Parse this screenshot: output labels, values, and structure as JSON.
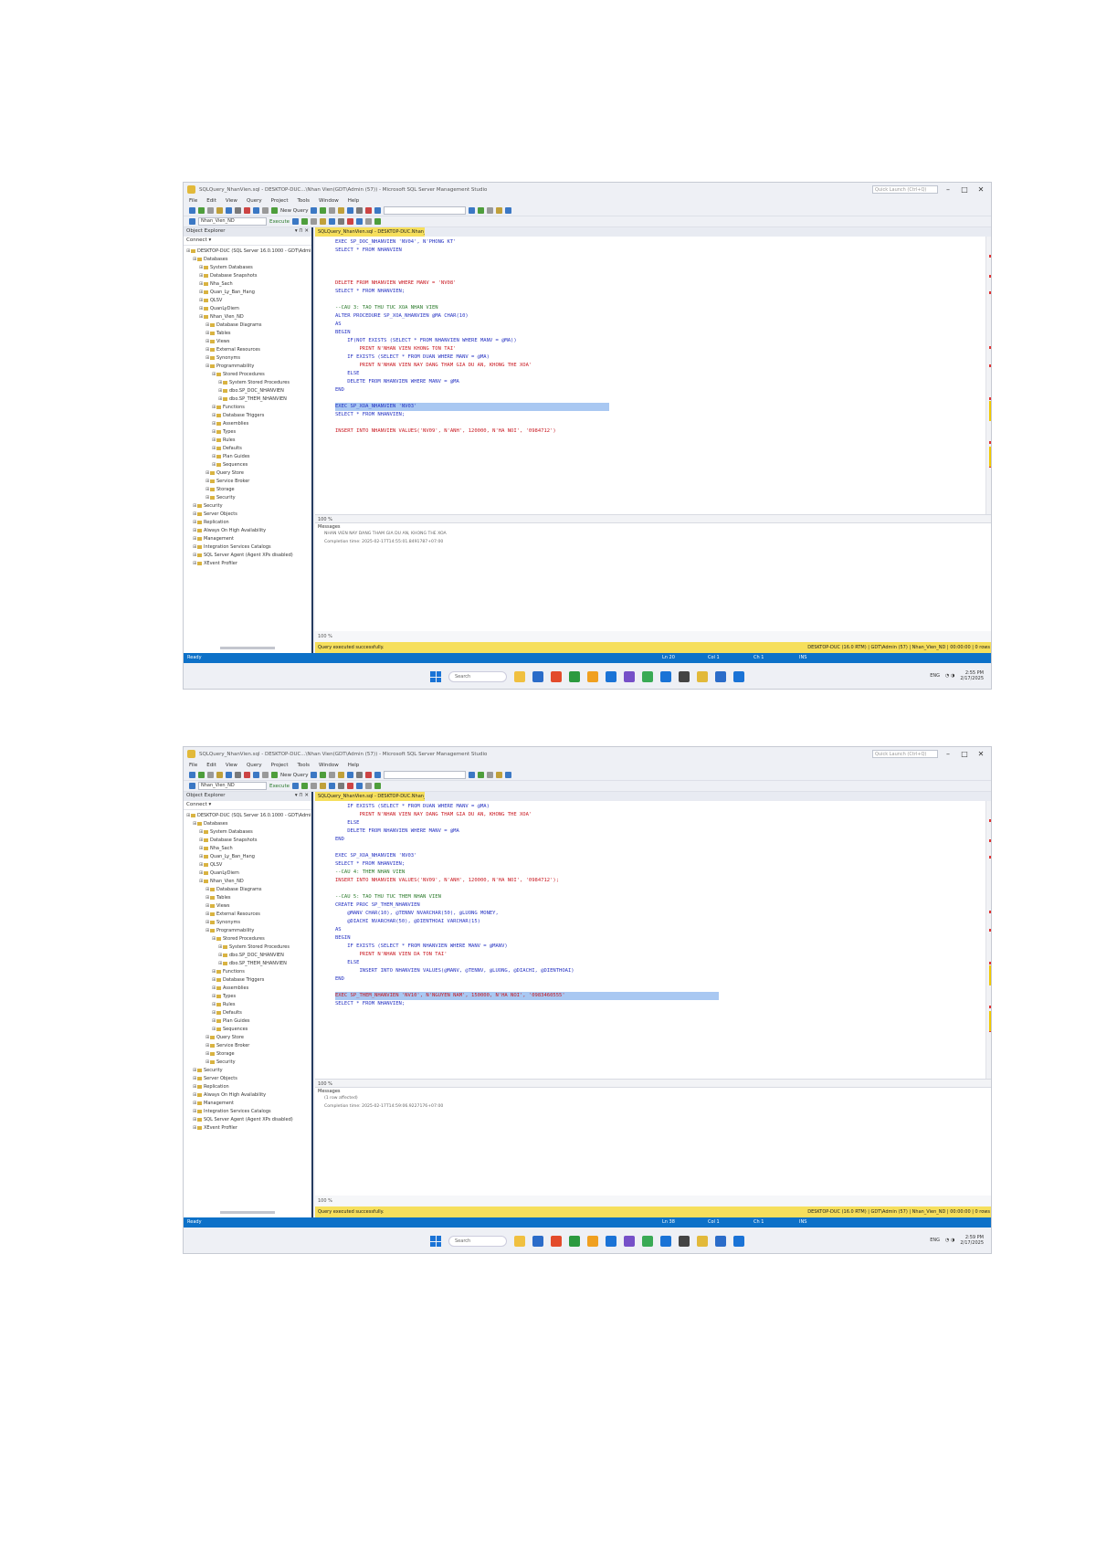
{
  "window": {
    "title": "SQLQuery_NhanVien.sql - DESKTOP-DUC...\\Nhan Vien(GDT\\Admin (57)) - Microsoft SQL Server Management Studio",
    "quick_launch": "Quick Launch (Ctrl+Q)",
    "minimize": "–",
    "maximize": "□",
    "close": "✕"
  },
  "menu": [
    "File",
    "Edit",
    "View",
    "Query",
    "Project",
    "Tools",
    "Window",
    "Help"
  ],
  "toolbar": {
    "new_query": "New Query",
    "database": "Nhan_Vien_ND",
    "execute": "Execute"
  },
  "object_explorer": {
    "title": "Object Explorer",
    "pin": "▾ ⊓ ✕",
    "connect": "Connect ▾",
    "tree": [
      {
        "indent": 0,
        "label": "DESKTOP-DUC (SQL Server 16.0.1000 - GDT\\Admin)"
      },
      {
        "indent": 1,
        "label": "Databases"
      },
      {
        "indent": 2,
        "label": "System Databases"
      },
      {
        "indent": 2,
        "label": "Database Snapshots"
      },
      {
        "indent": 2,
        "label": "Nha_Sach"
      },
      {
        "indent": 2,
        "label": "Quan_Ly_Ban_Hang"
      },
      {
        "indent": 2,
        "label": "QLSV"
      },
      {
        "indent": 2,
        "label": "QuanLyDiem"
      },
      {
        "indent": 2,
        "label": "Nhan_Vien_ND"
      },
      {
        "indent": 3,
        "label": "Database Diagrams"
      },
      {
        "indent": 3,
        "label": "Tables"
      },
      {
        "indent": 3,
        "label": "Views"
      },
      {
        "indent": 3,
        "label": "External Resources"
      },
      {
        "indent": 3,
        "label": "Synonyms"
      },
      {
        "indent": 3,
        "label": "Programmability"
      },
      {
        "indent": 4,
        "label": "Stored Procedures"
      },
      {
        "indent": 5,
        "label": "System Stored Procedures"
      },
      {
        "indent": 5,
        "label": "dbo.SP_DOC_NHANVIEN"
      },
      {
        "indent": 5,
        "label": "dbo.SP_THEM_NHANVIEN"
      },
      {
        "indent": 4,
        "label": "Functions"
      },
      {
        "indent": 4,
        "label": "Database Triggers"
      },
      {
        "indent": 4,
        "label": "Assemblies"
      },
      {
        "indent": 4,
        "label": "Types"
      },
      {
        "indent": 4,
        "label": "Rules"
      },
      {
        "indent": 4,
        "label": "Defaults"
      },
      {
        "indent": 4,
        "label": "Plan Guides"
      },
      {
        "indent": 4,
        "label": "Sequences"
      },
      {
        "indent": 3,
        "label": "Query Store"
      },
      {
        "indent": 3,
        "label": "Service Broker"
      },
      {
        "indent": 3,
        "label": "Storage"
      },
      {
        "indent": 3,
        "label": "Security"
      },
      {
        "indent": 1,
        "label": "Security"
      },
      {
        "indent": 1,
        "label": "Server Objects"
      },
      {
        "indent": 1,
        "label": "Replication"
      },
      {
        "indent": 1,
        "label": "Always On High Availability"
      },
      {
        "indent": 1,
        "label": "Management"
      },
      {
        "indent": 1,
        "label": "Integration Services Catalogs"
      },
      {
        "indent": 1,
        "label": "SQL Server Agent (Agent XPs disabled)"
      },
      {
        "indent": 1,
        "label": "XEvent Profiler"
      }
    ]
  },
  "tab": "SQLQuery_NhanVien.sql - DESKTOP-DUC.Nhan_Vien (57)* ✕",
  "screenshot1": {
    "code": [
      {
        "t": "EXEC SP_DOC_NHANVIEN 'NV04', N'PHONG KT'",
        "c": "blu"
      },
      {
        "t": "SELECT * FROM NHANVIEN",
        "c": "blu"
      },
      {
        "t": "",
        "c": "blk"
      },
      {
        "t": "",
        "c": "blk"
      },
      {
        "t": "",
        "c": "blk"
      },
      {
        "t": "DELETE FROM NHANVIEN WHERE MANV = 'NV08'",
        "c": "red"
      },
      {
        "t": "SELECT * FROM NHANVIEN;",
        "c": "blu"
      },
      {
        "t": "",
        "c": "blk"
      },
      {
        "t": "--CAU 3: TAO THU TUC XOA NHAN VIEN",
        "c": "grn"
      },
      {
        "t": "ALTER PROCEDURE SP_XOA_NHANVIEN @MA CHAR(10)",
        "c": "blu"
      },
      {
        "t": "AS",
        "c": "blu"
      },
      {
        "t": "BEGIN",
        "c": "blu"
      },
      {
        "t": "    IF(NOT EXISTS (SELECT * FROM NHANVIEN WHERE MANV = @MA))",
        "c": "blu"
      },
      {
        "t": "        PRINT N'NHAN VIEN KHONG TON TAI'",
        "c": "red"
      },
      {
        "t": "    IF EXISTS (SELECT * FROM DUAN WHERE MANV = @MA)",
        "c": "blu"
      },
      {
        "t": "        PRINT N'NHAN VIEN NAY DANG THAM GIA DU AN, KHONG THE XOA'",
        "c": "red"
      },
      {
        "t": "    ELSE",
        "c": "blu"
      },
      {
        "t": "    DELETE FROM NHANVIEN WHERE MANV = @MA",
        "c": "blu"
      },
      {
        "t": "END",
        "c": "blu"
      },
      {
        "t": "",
        "c": "blk"
      },
      {
        "t": "EXEC SP_XOA_NHANVIEN 'NV03'",
        "c": "blu",
        "hl": 1
      },
      {
        "t": "SELECT * FROM NHANVIEN;",
        "c": "blu"
      },
      {
        "t": "",
        "c": "blk"
      },
      {
        "t": "INSERT INTO NHANVIEN VALUES('NV09', N'ANH', 120000, N'HA NOI', '0984712')",
        "c": "red"
      }
    ],
    "zoom": "100 %",
    "messages_tab": "Messages",
    "messages": [
      "NHAN VIEN NAY DANG THAM GIA DU AN, KHONG THE XOA",
      "",
      "Completion time: 2025-02-17T14:55:01.8491787+07:00"
    ],
    "status_zoom": "100 %",
    "query_status": "Query executed successfully.",
    "query_info": "DESKTOP-DUC (16.0 RTM) | GDT\\Admin (57) | Nhan_Vien_ND | 00:00:00 | 0 rows",
    "ready": "Ready",
    "ln": "Ln 20",
    "col": "Col 1",
    "ch": "Ch 1",
    "ins": "INS",
    "search": "Search",
    "tray": "ENG",
    "time": "2:55 PM",
    "date": "2/17/2025"
  },
  "screenshot2": {
    "code": [
      {
        "t": "    IF EXISTS (SELECT * FROM DUAN WHERE MANV = @MA)",
        "c": "blu"
      },
      {
        "t": "        PRINT N'NHAN VIEN NAY DANG THAM GIA DU AN, KHONG THE XOA'",
        "c": "red"
      },
      {
        "t": "    ELSE",
        "c": "blu"
      },
      {
        "t": "    DELETE FROM NHANVIEN WHERE MANV = @MA",
        "c": "blu"
      },
      {
        "t": "END",
        "c": "blu"
      },
      {
        "t": "",
        "c": "blk"
      },
      {
        "t": "EXEC SP_XOA_NHANVIEN 'NV03'",
        "c": "blu"
      },
      {
        "t": "SELECT * FROM NHANVIEN;",
        "c": "blu"
      },
      {
        "t": "--CAU 4: THEM NHAN VIEN",
        "c": "grn"
      },
      {
        "t": "INSERT INTO NHANVIEN VALUES('NV09', N'ANH', 120000, N'HA NOI', '0984712');",
        "c": "red"
      },
      {
        "t": "",
        "c": "blk"
      },
      {
        "t": "--CAU 5: TAO THU TUC THEM NHAN VIEN",
        "c": "grn"
      },
      {
        "t": "CREATE PROC SP_THEM_NHANVIEN",
        "c": "blu"
      },
      {
        "t": "    @MANV CHAR(10), @TENNV NVARCHAR(50), @LUONG MONEY,",
        "c": "blu"
      },
      {
        "t": "    @DIACHI NVARCHAR(50), @DIENTHOAI VARCHAR(15)",
        "c": "blu"
      },
      {
        "t": "AS",
        "c": "blu"
      },
      {
        "t": "BEGIN",
        "c": "blu"
      },
      {
        "t": "    IF EXISTS (SELECT * FROM NHANVIEN WHERE MANV = @MANV)",
        "c": "blu"
      },
      {
        "t": "        PRINT N'NHAN VIEN DA TON TAI'",
        "c": "red"
      },
      {
        "t": "    ELSE",
        "c": "blu"
      },
      {
        "t": "        INSERT INTO NHANVIEN VALUES(@MANV, @TENNV, @LUONG, @DIACHI, @DIENTHOAI)",
        "c": "blu"
      },
      {
        "t": "END",
        "c": "blu"
      },
      {
        "t": "",
        "c": "blk"
      },
      {
        "t": "EXEC SP_THEM_NHANVIEN 'NV10', N'NGUYEN NAM', 150000, N'HA NOI', '0983460555'",
        "c": "red",
        "hl": 1
      },
      {
        "t": "SELECT * FROM NHANVIEN;",
        "c": "blu"
      }
    ],
    "zoom": "100 %",
    "messages_tab": "Messages",
    "messages": [
      "(1 row affected)",
      "",
      "Completion time: 2025-02-17T14:59:06.9227176+07:00"
    ],
    "status_zoom": "100 %",
    "query_status": "Query executed successfully.",
    "query_info": "DESKTOP-DUC (16.0 RTM) | GDT\\Admin (57) | Nhan_Vien_ND | 00:00:00 | 0 rows",
    "ready": "Ready",
    "ln": "Ln 38",
    "col": "Col 1",
    "ch": "Ch 1",
    "ins": "INS",
    "search": "Search",
    "tray": "ENG",
    "time": "2:59 PM",
    "date": "2/17/2025"
  }
}
